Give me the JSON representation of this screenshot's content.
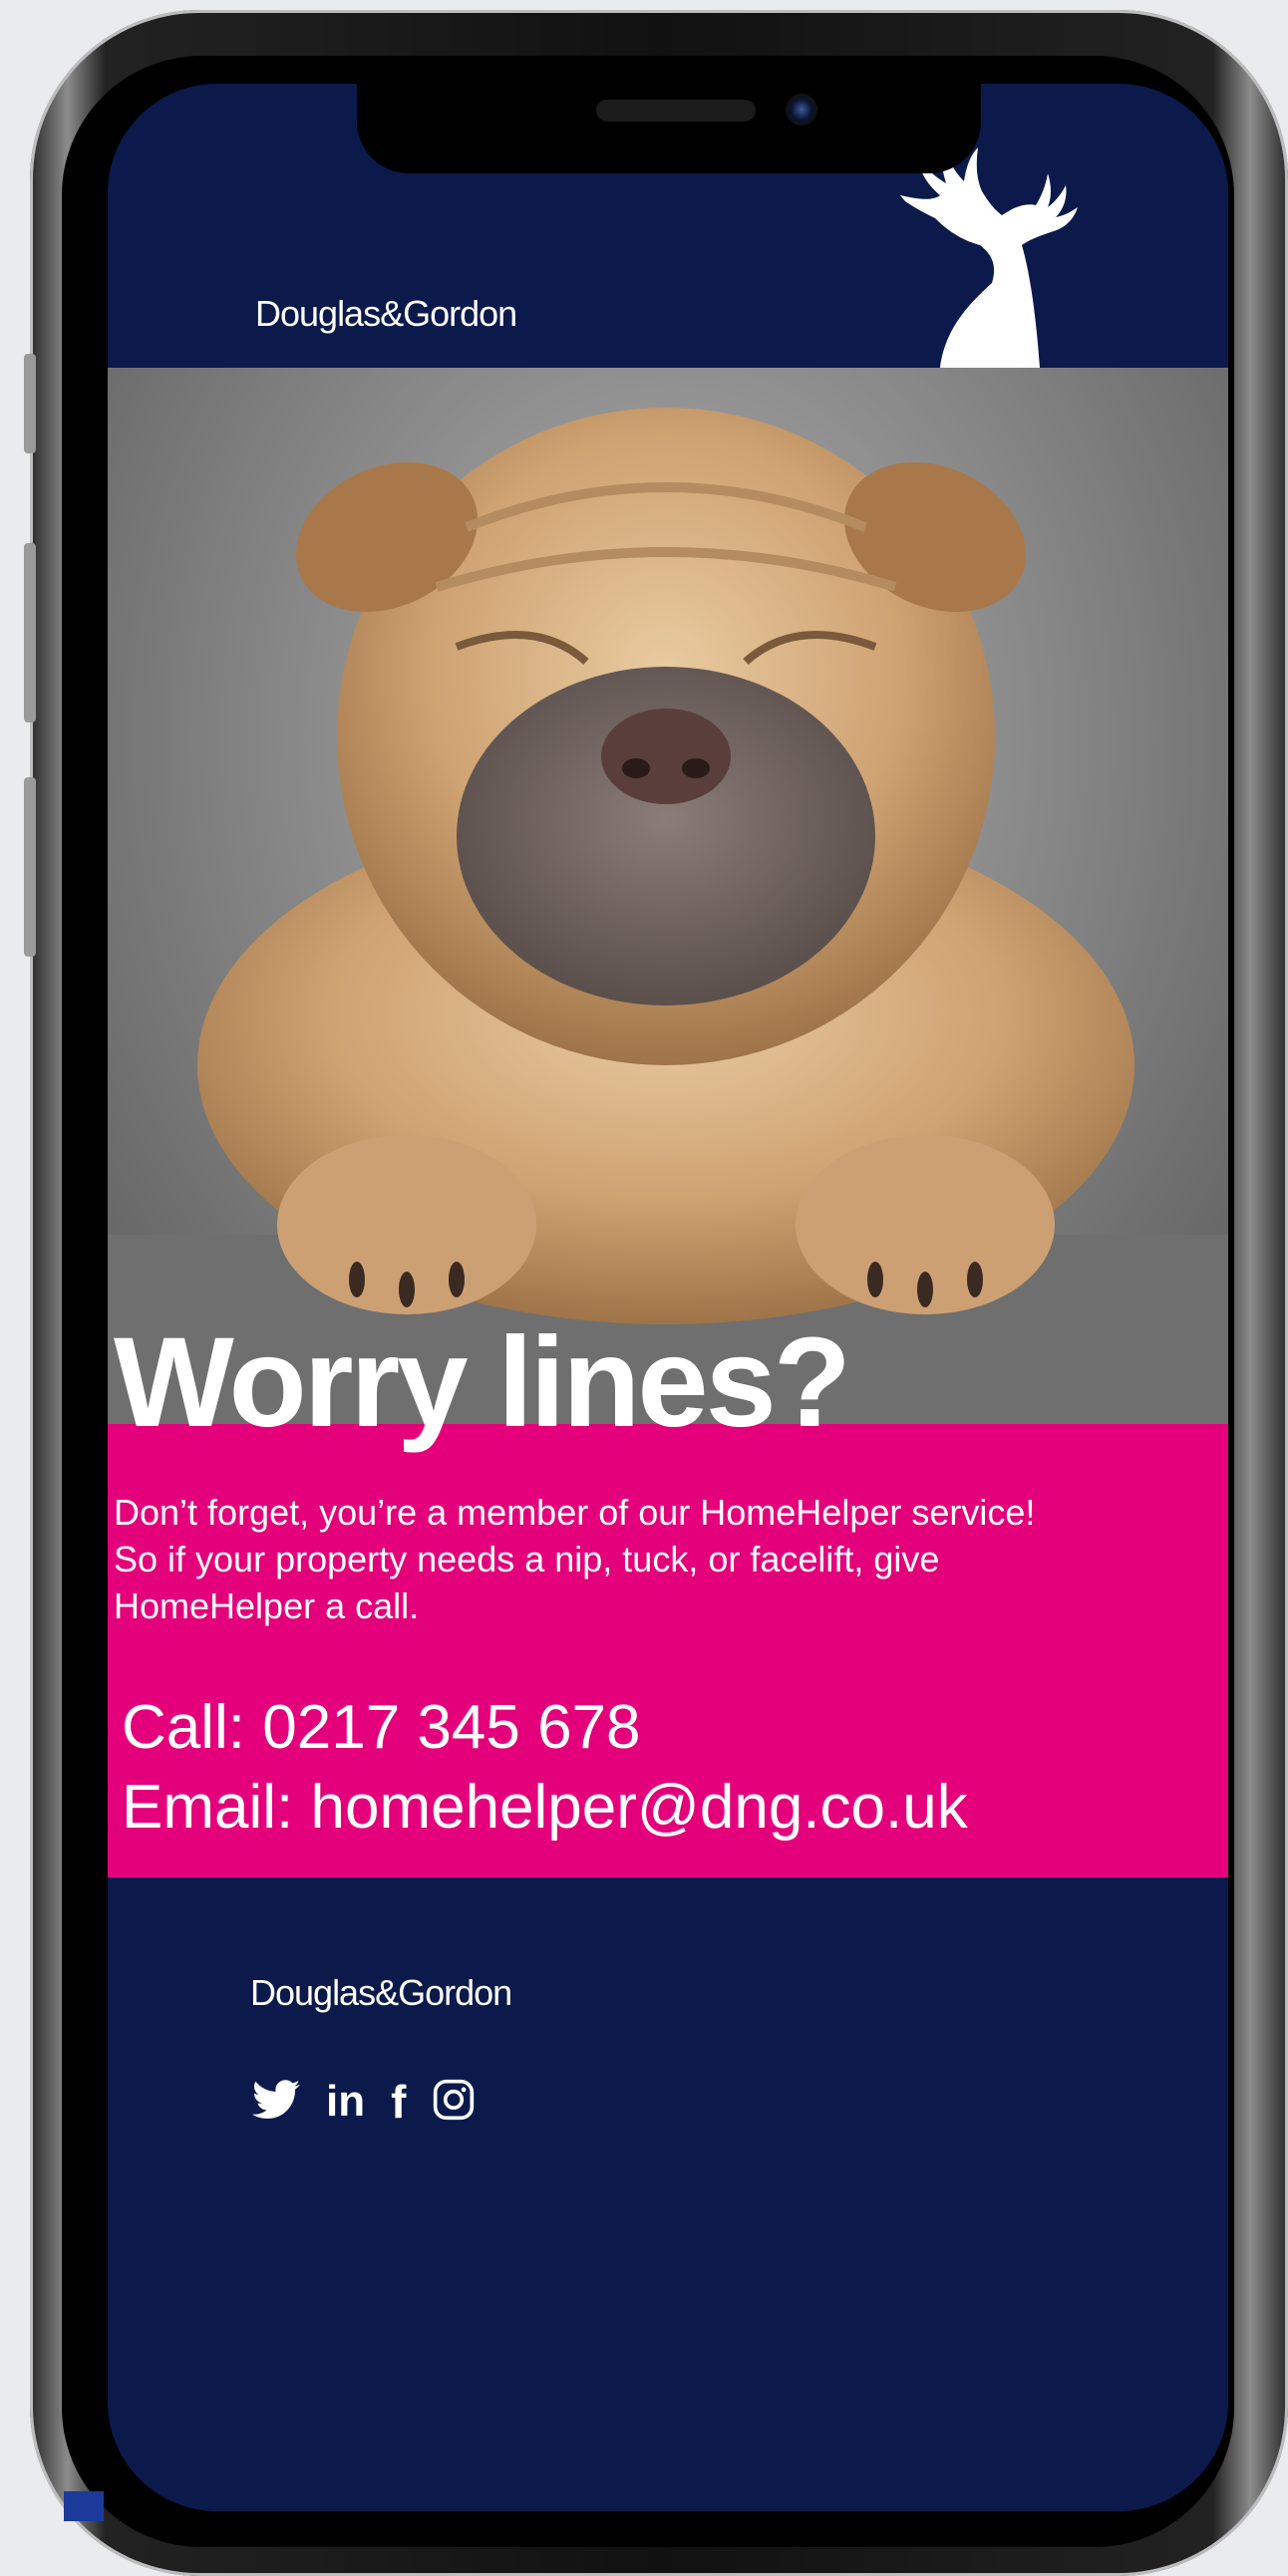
{
  "brand": {
    "name": "Douglas&Gordon",
    "colors": {
      "navy": "#0b1a4b",
      "pink": "#e4007b",
      "white": "#ffffff"
    }
  },
  "header": {
    "logo": "Douglas&Gordon",
    "emblem_icon": "stag-icon"
  },
  "hero": {
    "image_subject": "shar-pei puppy",
    "headline": "Worry lines?"
  },
  "message": {
    "lines": [
      "Don’t forget, you’re a member of our HomeHelper service!",
      "So if your property needs a nip, tuck, or facelift, give",
      "HomeHelper a call."
    ],
    "call": "Call: 0217 345 678",
    "email": "Email: homehelper@dng.co.uk"
  },
  "footer": {
    "logo": "Douglas&Gordon",
    "social": [
      {
        "icon": "twitter-icon",
        "glyph": ""
      },
      {
        "icon": "linkedin-icon",
        "glyph": "in"
      },
      {
        "icon": "facebook-icon",
        "glyph": "f"
      },
      {
        "icon": "instagram-icon",
        "glyph": ""
      }
    ]
  }
}
